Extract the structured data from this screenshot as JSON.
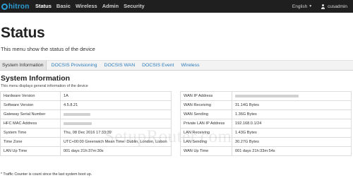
{
  "navbar": {
    "brand": "hitron",
    "items": [
      {
        "label": "Status",
        "active": true
      },
      {
        "label": "Basic",
        "active": false
      },
      {
        "label": "Wireless",
        "active": false
      },
      {
        "label": "Admin",
        "active": false
      },
      {
        "label": "Security",
        "active": false
      }
    ],
    "language": "English",
    "username": "cusadmin"
  },
  "page": {
    "title": "Status",
    "subtitle": "This menu show the status of the device"
  },
  "tabs": [
    {
      "label": "System Information",
      "active": true
    },
    {
      "label": "DOCSIS Provisioning",
      "active": false
    },
    {
      "label": "DOCSIS WAN",
      "active": false
    },
    {
      "label": "DOCSIS Event",
      "active": false
    },
    {
      "label": "Wireless",
      "active": false
    }
  ],
  "section": {
    "title": "System Information",
    "subtitle": "This menu displays general information of the device"
  },
  "left_table": [
    {
      "key": "Hardware Version",
      "value": "1A"
    },
    {
      "key": "Software Version",
      "value": "4.5.8.21"
    },
    {
      "key": "Gateway Serial Number",
      "value": ""
    },
    {
      "key": "HFC MAC Address",
      "value": ""
    },
    {
      "key": "System Time",
      "value": "Thu, 08 Dec 2016 17:33:39"
    },
    {
      "key": "Time Zone",
      "value": "UTC+00:00 Greenwich Mean Time: Dublin, London, Lisbon"
    },
    {
      "key": "LAN Up Time",
      "value": "001 days 21h:37m:30s"
    }
  ],
  "right_table": [
    {
      "key": "WAN IP Address",
      "value": ""
    },
    {
      "key": "WAN Receiving",
      "value": "31.14G Bytes"
    },
    {
      "key": "WAN Sending",
      "value": "1.36G Bytes"
    },
    {
      "key": "Private LAN IP Address",
      "value": "192.168.0.1/24"
    },
    {
      "key": "LAN Receiving",
      "value": "1.43G Bytes"
    },
    {
      "key": "LAN Sending",
      "value": "30.27G Bytes"
    },
    {
      "key": "WAN Up Time",
      "value": "001 days 21h:33m:54s"
    }
  ],
  "watermark": "SetupRouter.com",
  "footnote": "* Traffic Counter is count since the last system boot up.",
  "colors": {
    "navbar_bg": "#1f1f1f",
    "brand_accent": "#2a9fd6",
    "link": "#2a7bbd"
  }
}
